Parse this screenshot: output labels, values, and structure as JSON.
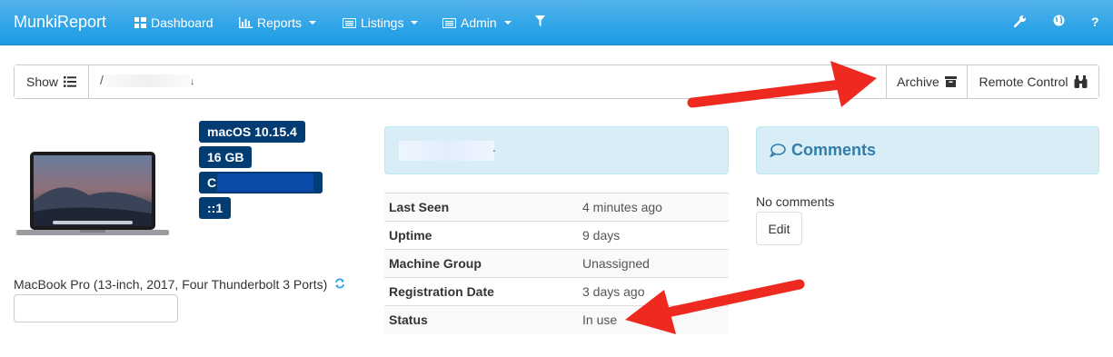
{
  "navbar": {
    "brand": "MunkiReport",
    "items": [
      {
        "label": "Dashboard",
        "icon": "dashboard-icon"
      },
      {
        "label": "Reports",
        "icon": "chart-icon"
      },
      {
        "label": "Listings",
        "icon": "list-icon"
      },
      {
        "label": "Admin",
        "icon": "list-icon"
      }
    ],
    "right_icons": [
      "wrench-icon",
      "globe-icon",
      "help-icon"
    ],
    "help_label": "?"
  },
  "toolbar": {
    "show_label": "Show",
    "machine_field_prefix": "/",
    "machine_field_suffix": "↓",
    "archive_label": "Archive",
    "remote_label": "Remote Control"
  },
  "device": {
    "labels": [
      "macOS 10.15.4",
      "16 GB",
      "C",
      "::1"
    ],
    "model": "MacBook Pro (13-inch, 2017, Four Thunderbolt 3 Ports)"
  },
  "info": {
    "name_suffix": ".",
    "rows": [
      {
        "key": "Last Seen",
        "value": "4 minutes ago"
      },
      {
        "key": "Uptime",
        "value": "9 days"
      },
      {
        "key": "Machine Group",
        "value": "Unassigned"
      },
      {
        "key": "Registration Date",
        "value": "3 days ago"
      },
      {
        "key": "Status",
        "value": "In use"
      }
    ]
  },
  "comments": {
    "title": "Comments",
    "empty_text": "No comments",
    "edit_label": "Edit"
  },
  "colors": {
    "navbar": "#2fa4e7",
    "label_bg": "#033c73",
    "panel_bg": "#d9edf7",
    "panel_title": "#317eac",
    "annotation_arrow": "#ee2a20"
  }
}
